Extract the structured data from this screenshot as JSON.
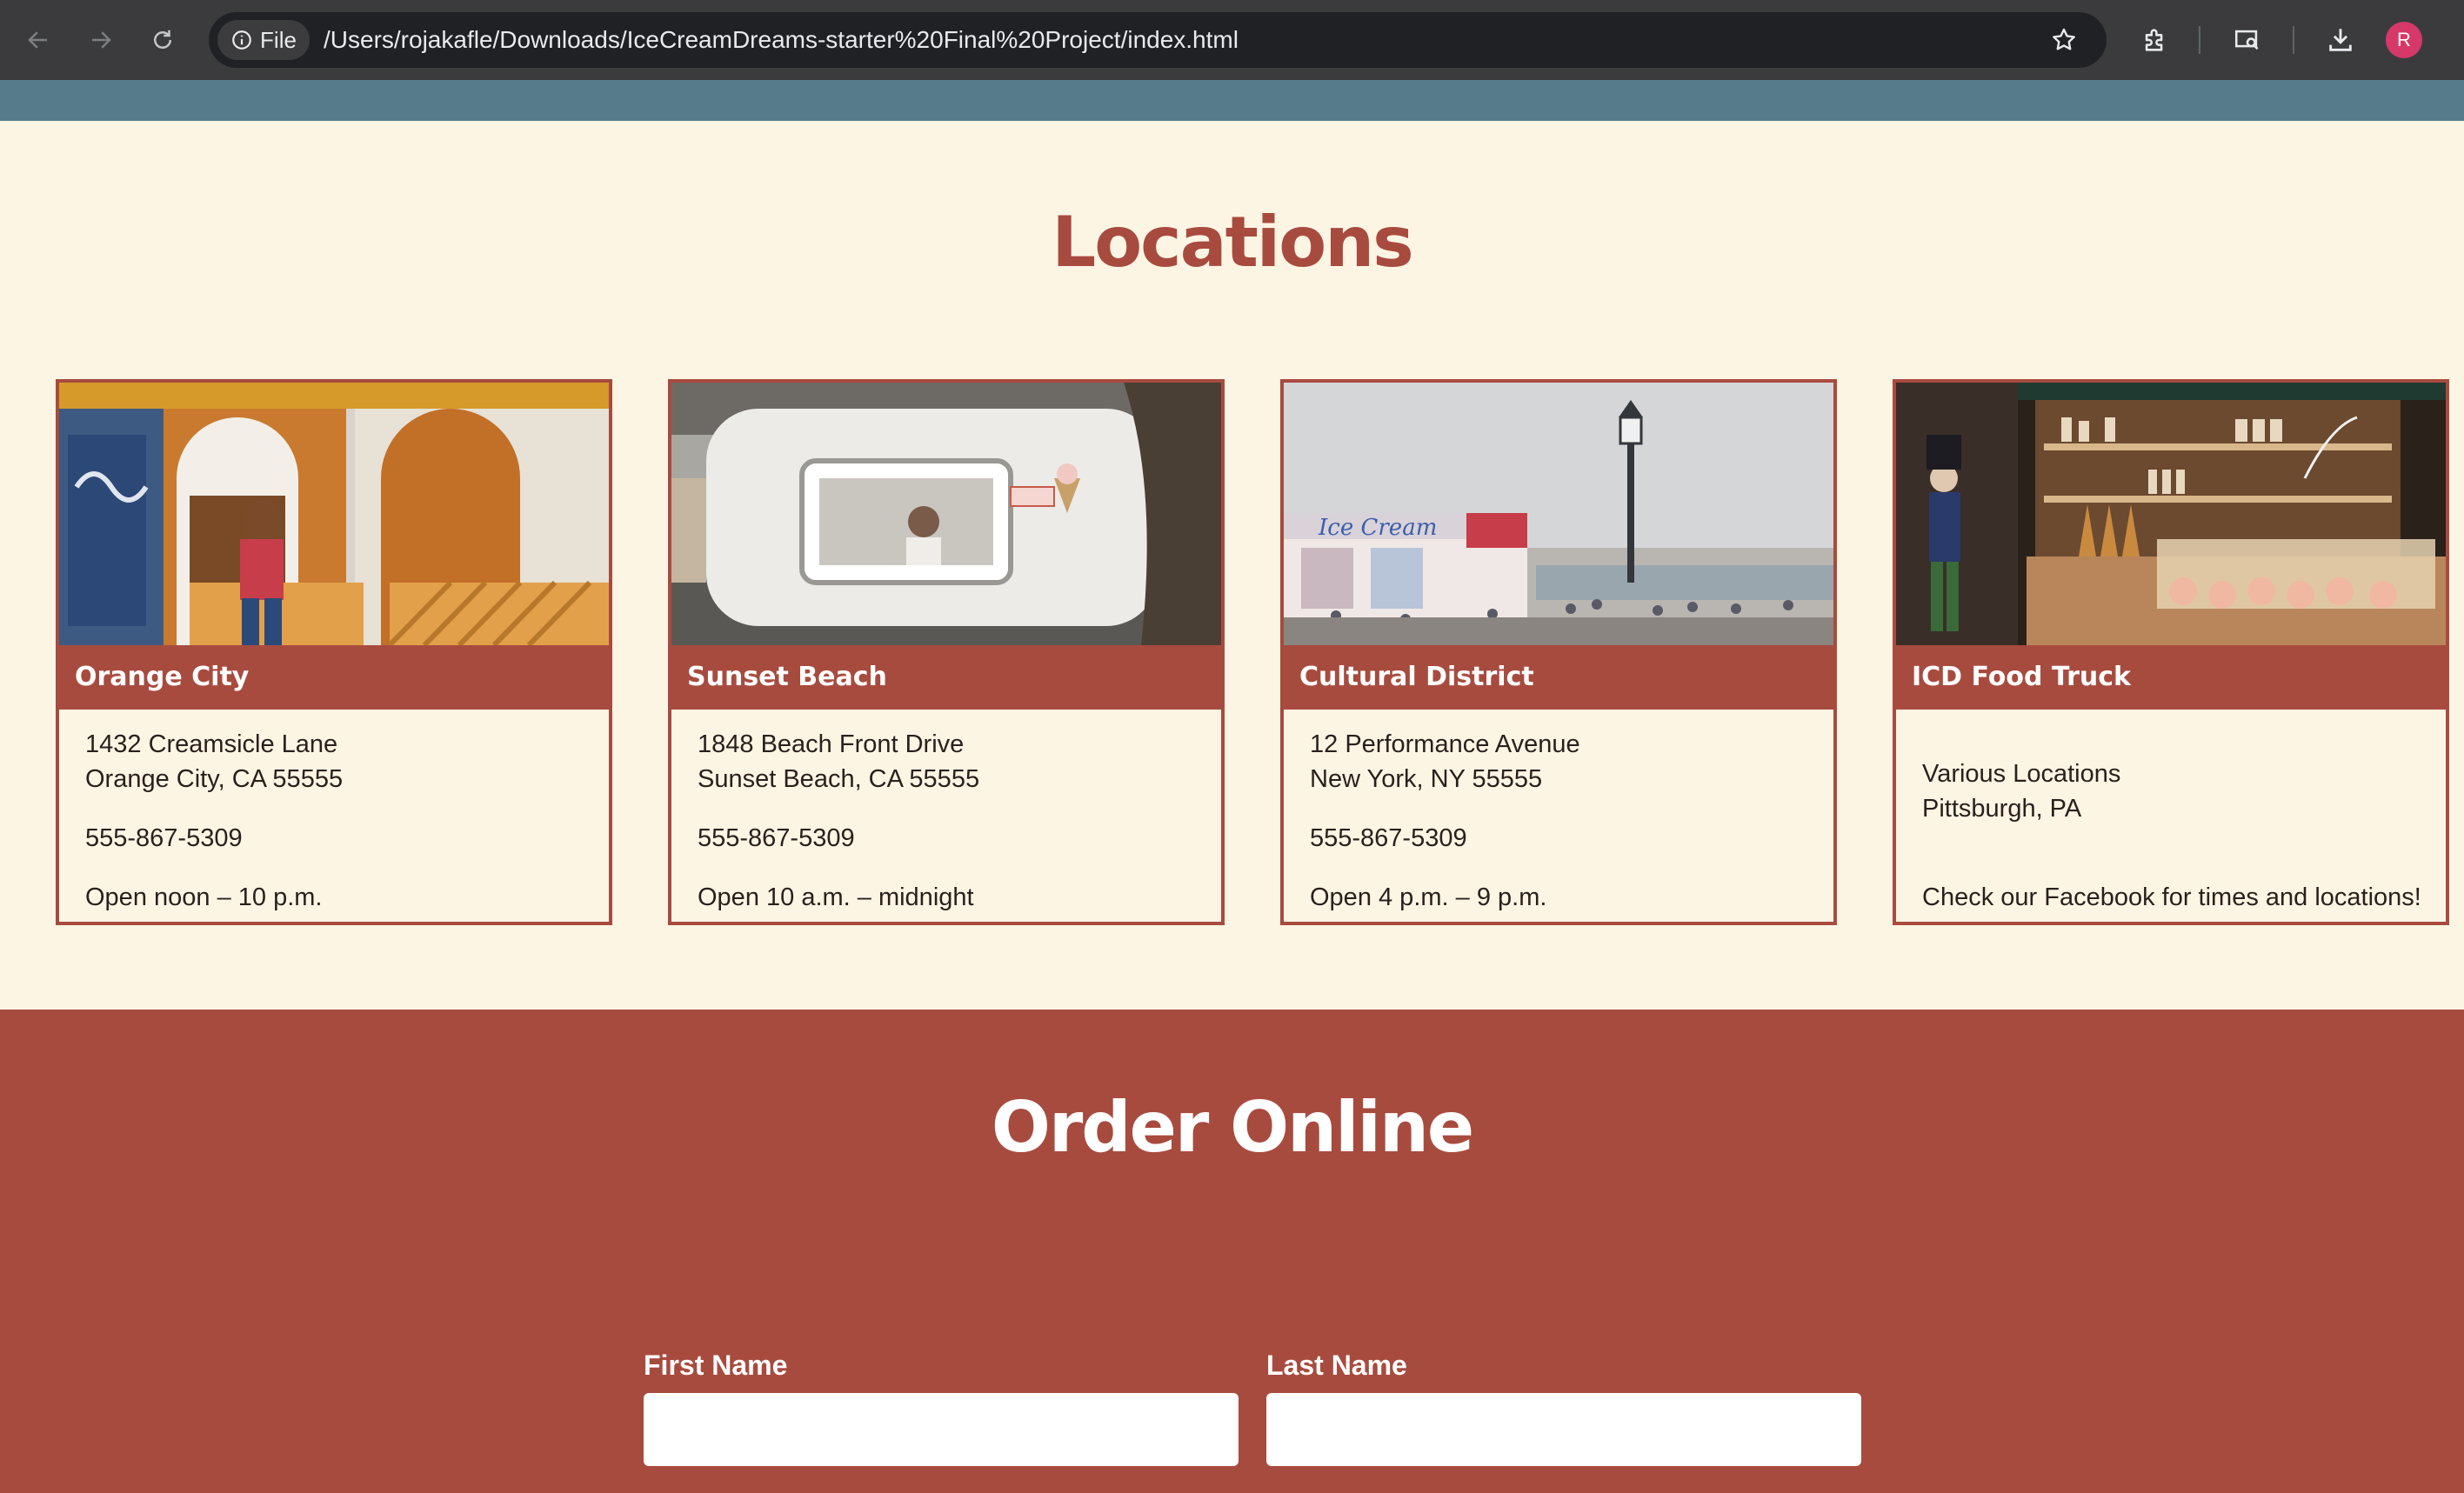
{
  "browser": {
    "file_chip_label": "File",
    "url": "/Users/rojakafle/Downloads/IceCreamDreams-starter%20Final%20Project/index.html",
    "profile_initial": "R"
  },
  "locations": {
    "title": "Locations",
    "cards": [
      {
        "name": "Orange City",
        "address_line1": "1432 Creamsicle Lane",
        "address_line2": "Orange City, CA 55555",
        "phone": "555-867-5309",
        "hours": "Open noon – 10 p.m."
      },
      {
        "name": "Sunset Beach",
        "address_line1": "1848 Beach Front Drive",
        "address_line2": "Sunset Beach, CA 55555",
        "phone": "555-867-5309",
        "hours": "Open 10 a.m. – midnight"
      },
      {
        "name": "Cultural District",
        "address_line1": "12 Performance Avenue",
        "address_line2": "New York, NY 55555",
        "phone": "555-867-5309",
        "hours": "Open 4 p.m. – 9 p.m."
      },
      {
        "name": "ICD Food Truck",
        "address_line1": "Various Locations",
        "address_line2": "Pittsburgh, PA",
        "note": "Check our Facebook for times and locations!"
      }
    ]
  },
  "order": {
    "title": "Order Online",
    "first_name_label": "First Name",
    "last_name_label": "Last Name",
    "first_name_value": "",
    "last_name_value": ""
  },
  "colors": {
    "brand_red": "#a84b3f",
    "cream_background": "#fdf5e4",
    "header_strip": "#567b8b"
  }
}
